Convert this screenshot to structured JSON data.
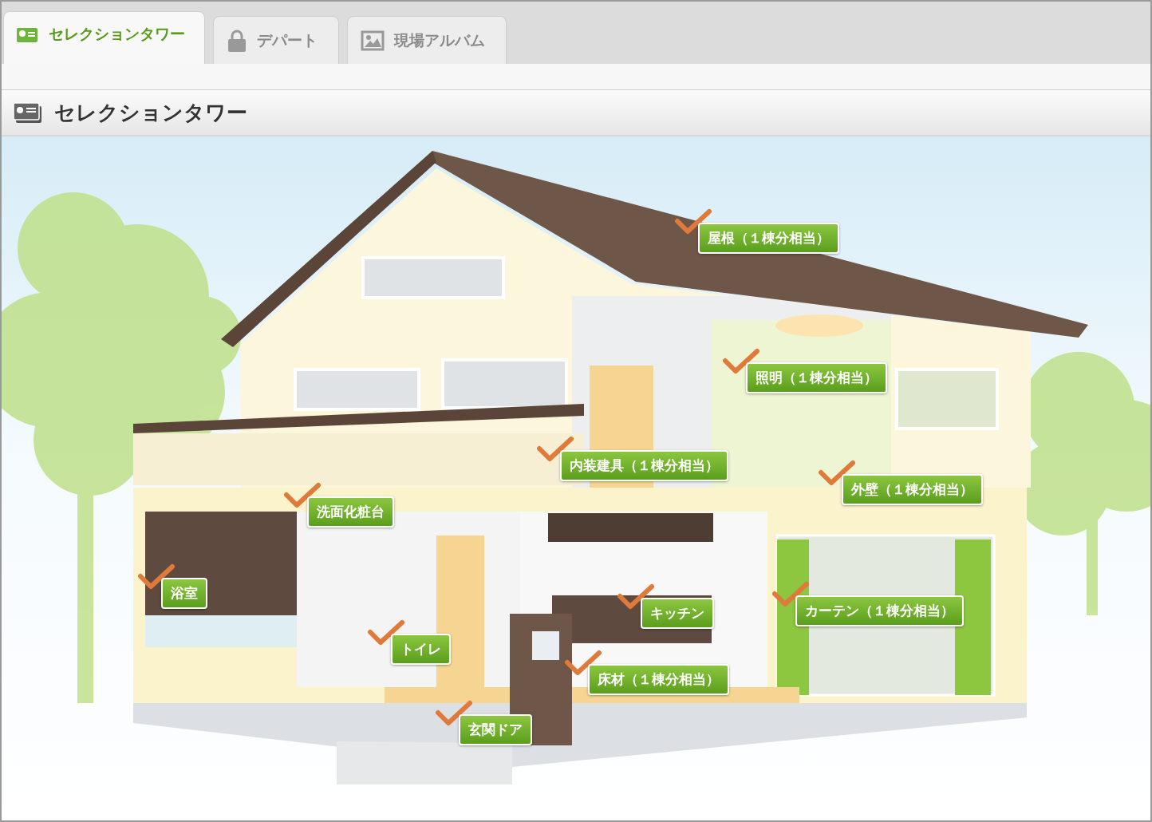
{
  "tabs": [
    {
      "label": "セレクションタワー",
      "kind": "tower",
      "selected": true
    },
    {
      "label": "デパート",
      "kind": "lock",
      "selected": false
    },
    {
      "label": "現場アルバム",
      "kind": "photo",
      "selected": false
    }
  ],
  "header": {
    "title": "セレクションタワー"
  },
  "hotspots": [
    {
      "label": "屋根（１棟分相当）"
    },
    {
      "label": "照明（１棟分相当）"
    },
    {
      "label": "内装建具（１棟分相当）"
    },
    {
      "label": "外壁（１棟分相当）"
    },
    {
      "label": "洗面化粧台"
    },
    {
      "label": "浴室"
    },
    {
      "label": "キッチン"
    },
    {
      "label": "カーテン（１棟分相当）"
    },
    {
      "label": "トイレ"
    },
    {
      "label": "床材（１棟分相当）"
    },
    {
      "label": "玄関ドア"
    }
  ]
}
